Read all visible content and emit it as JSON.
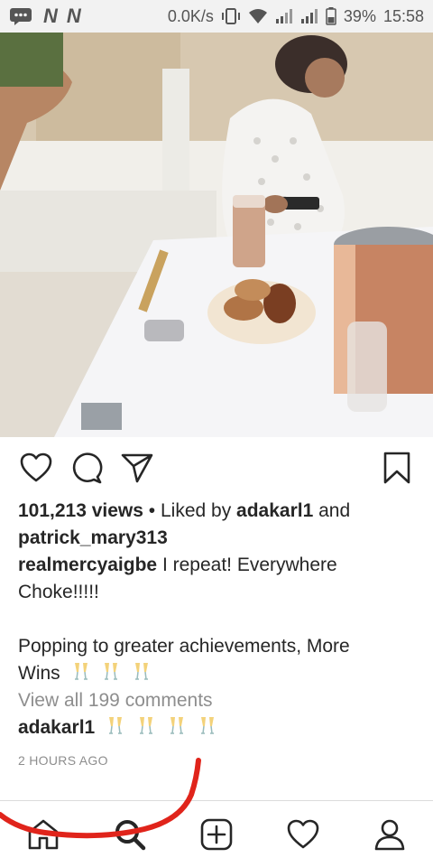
{
  "status_bar": {
    "network_speed": "0.0K/s",
    "battery_percent": "39%",
    "time": "15:58",
    "notification_marks": [
      "N",
      "N"
    ],
    "icons": [
      "chat-icon",
      "vibrate-icon",
      "wifi-icon",
      "signal-icon",
      "signal-icon",
      "battery-icon"
    ]
  },
  "post": {
    "actions": [
      "heart-icon",
      "comment-icon",
      "share-icon",
      "bookmark-icon"
    ],
    "views": "101,213 views",
    "liked_by_prefix": " • Liked by ",
    "liked_by_user": "adakarl1",
    "liked_by_and": " and",
    "liked_by_user2": "patrick_mary313",
    "caption_user": "realmercyaigbe",
    "caption_line1": " I repeat!  Everywhere",
    "caption_line2": "Choke!!!!!",
    "caption_line3": "Popping to greater achievements, More",
    "caption_line4": "Wins",
    "view_comments": "View all 199 comments",
    "comment_user": "adakarl1",
    "time_ago": "2 HOURS AGO"
  },
  "bottom_nav": {
    "items": [
      "home-icon",
      "search-icon",
      "add-post-icon",
      "activity-icon",
      "profile-icon"
    ]
  },
  "colors": {
    "text": "#262626",
    "muted": "#8e8e8e",
    "annotation": "#e0241b"
  }
}
